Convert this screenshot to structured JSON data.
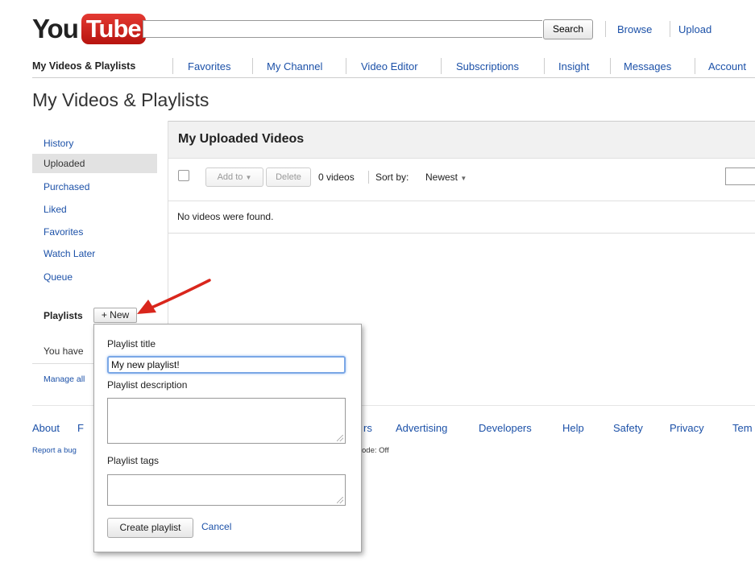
{
  "brand": {
    "you": "You",
    "tube": "Tube"
  },
  "header": {
    "search_placeholder": "",
    "search_button": "Search",
    "browse": "Browse",
    "upload": "Upload"
  },
  "nav": {
    "items": [
      "My Videos & Playlists",
      "Favorites",
      "My Channel",
      "Video Editor",
      "Subscriptions",
      "Insight",
      "Messages",
      "Account"
    ]
  },
  "page_title": "My Videos & Playlists",
  "sidebar": {
    "items": [
      "History",
      "Uploaded",
      "Purchased",
      "Liked",
      "Favorites",
      "Watch Later",
      "Queue"
    ],
    "selected": "Uploaded",
    "playlists_label": "Playlists",
    "new_button": "+ New",
    "you_have": "You have",
    "manage_all": "Manage all"
  },
  "main": {
    "title": "My Uploaded Videos",
    "add_to": "Add to",
    "delete": "Delete",
    "video_count": "0 videos",
    "sort_by": "Sort by:",
    "sort_value": "Newest",
    "empty_message": "No videos were found."
  },
  "footer": {
    "links": [
      "About",
      "F",
      "rs",
      "Advertising",
      "Developers",
      "Help",
      "Safety",
      "Privacy",
      "Tem"
    ],
    "report_bug": "Report a bug",
    "mode_text": "ode: Off"
  },
  "popup": {
    "title_label": "Playlist title",
    "title_value": "My new playlist!",
    "description_label": "Playlist description",
    "tags_label": "Playlist tags",
    "create_button": "Create playlist",
    "cancel": "Cancel"
  },
  "colors": {
    "link": "#1c51a8",
    "logo_red": "#cc1f18",
    "arrow_red": "#d9261c",
    "focus_blue": "#7aa7e6"
  }
}
